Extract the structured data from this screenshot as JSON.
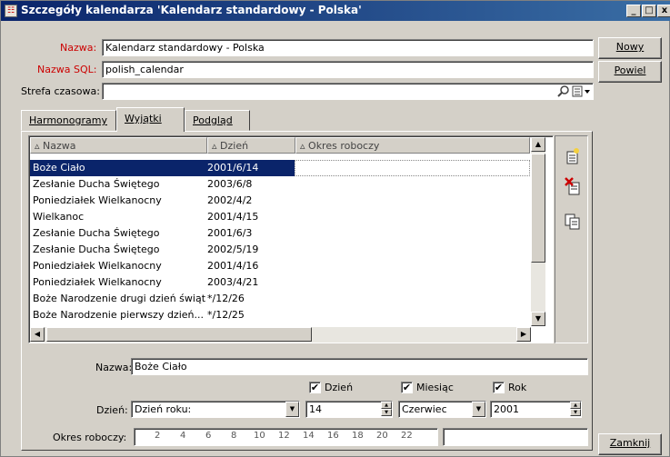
{
  "window": {
    "title": "Szczegóły kalendarza 'Kalendarz standardowy - Polska'",
    "buttons": [
      "_",
      "□",
      "x"
    ]
  },
  "form": {
    "nazwa_label": "Nazwa:",
    "nazwa_value": "Kalendarz standardowy - Polska",
    "sql_label": "Nazwa SQL:",
    "sql_value": "polish_calendar",
    "strefa_label": "Strefa czasowa:",
    "strefa_value": ""
  },
  "side_buttons": {
    "new": "Nowy",
    "repeat": "Powiel",
    "close": "Zamknij"
  },
  "tabs": [
    {
      "label": "Harmonogramy"
    },
    {
      "label": "Wyjątki"
    },
    {
      "label": "Podgląd"
    }
  ],
  "table": {
    "headers": [
      "Nazwa",
      "Dzień",
      "Okres roboczy"
    ],
    "rows": [
      {
        "name": "Boże Ciało",
        "day": "2001/6/14",
        "period": ""
      },
      {
        "name": "Zesłanie Ducha Świętego",
        "day": "2003/6/8",
        "period": ""
      },
      {
        "name": "Poniedziałek Wielkanocny",
        "day": "2002/4/2",
        "period": ""
      },
      {
        "name": "Wielkanoc",
        "day": "2001/4/15",
        "period": ""
      },
      {
        "name": "Zesłanie Ducha Świętego",
        "day": "2001/6/3",
        "period": ""
      },
      {
        "name": "Zesłanie Ducha Świętego",
        "day": "2002/5/19",
        "period": ""
      },
      {
        "name": "Poniedziałek Wielkanocny",
        "day": "2001/4/16",
        "period": ""
      },
      {
        "name": "Poniedziałek Wielkanocny",
        "day": "2003/4/21",
        "period": ""
      },
      {
        "name": "Boże Narodzenie drugi dzień świąt",
        "day": "*/12/26",
        "period": ""
      },
      {
        "name": "Boże Narodzenie pierwszy dzień...",
        "day": "*/12/25",
        "period": ""
      }
    ]
  },
  "detail": {
    "nazwa_label": "Nazwa:",
    "nazwa_value": "Boże Ciało",
    "check_day": "Dzień",
    "check_month": "Miesiąc",
    "check_year": "Rok",
    "dzien_label": "Dzień:",
    "dzien_type": "Dzień roku:",
    "day_value": "14",
    "month_value": "Czerwiec",
    "year_value": "2001",
    "okres_label": "Okres roboczy:",
    "ruler_ticks": [
      "2",
      "4",
      "6",
      "8",
      "10",
      "12",
      "14",
      "16",
      "18",
      "20",
      "22"
    ]
  },
  "icons": {
    "search": "search-icon",
    "list": "list-icon",
    "new_row": "new-row-icon",
    "delete_row": "delete-row-icon",
    "copy_row": "copy-row-icon"
  }
}
